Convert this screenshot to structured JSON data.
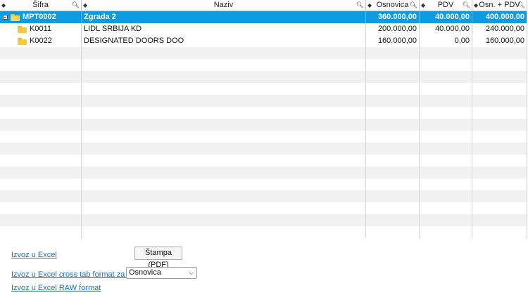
{
  "columns": {
    "sifra": "Šifra",
    "naziv": "Naziv",
    "osnovica": "Osnovica",
    "pdv": "PDV",
    "ukupno": "Osn. + PDV"
  },
  "rows": [
    {
      "code": "MPT0002",
      "name": "Zgrada 2",
      "osnovica": "360.000,00",
      "pdv": "40.000,00",
      "ukupno": "400.000,00",
      "selected": true,
      "level": 0
    },
    {
      "code": "K0011",
      "name": "LIDL SRBIJA KD",
      "osnovica": "200.000,00",
      "pdv": "40.000,00",
      "ukupno": "240.000,00",
      "selected": false,
      "level": 1
    },
    {
      "code": "K0022",
      "name": "DESIGNATED DOORS DOO",
      "osnovica": "160.000,00",
      "pdv": "0,00",
      "ukupno": "160.000,00",
      "selected": false,
      "level": 1
    }
  ],
  "footer": {
    "export_excel": "Izvoz u Excel",
    "print_pdf": "Štampa (PDF)",
    "export_crosstab": "Izvoz u Excel cross tab format za iznos:",
    "crosstab_value": "Osnovica",
    "export_raw": "Izvoz u Excel RAW format"
  },
  "colors": {
    "selected_row": "#0e9bdf",
    "link": "#1a6fc4",
    "folder": "#f5c842"
  }
}
